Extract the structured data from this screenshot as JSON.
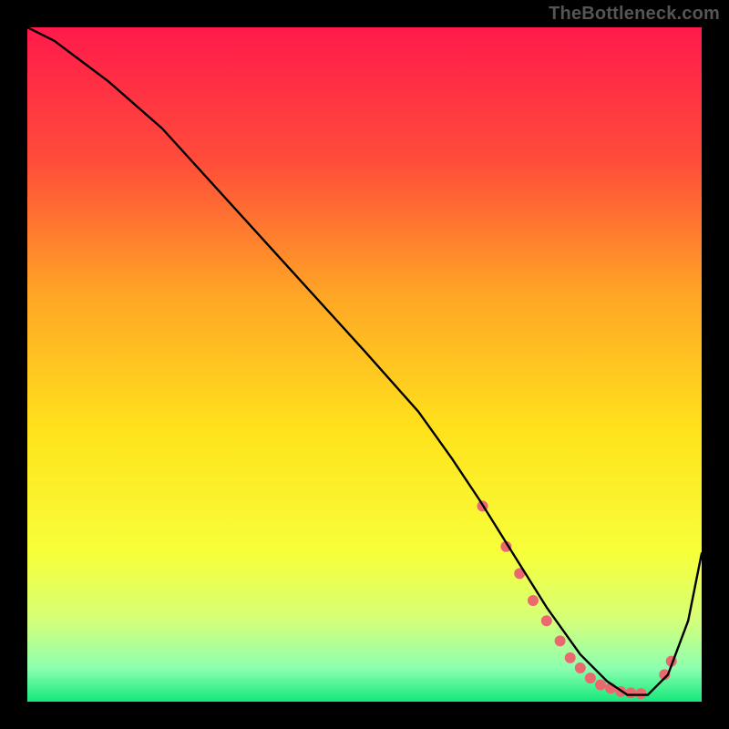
{
  "watermark": "TheBottleneck.com",
  "chart_data": {
    "type": "line",
    "title": "",
    "xlabel": "",
    "ylabel": "",
    "xlim": [
      0,
      100
    ],
    "ylim": [
      0,
      100
    ],
    "grid": false,
    "legend": false,
    "gradient_stops": [
      {
        "offset": 0,
        "color": "#ff1a4b"
      },
      {
        "offset": 20,
        "color": "#ff4d3a"
      },
      {
        "offset": 40,
        "color": "#ffa725"
      },
      {
        "offset": 60,
        "color": "#ffe31c"
      },
      {
        "offset": 78,
        "color": "#f7ff3a"
      },
      {
        "offset": 88,
        "color": "#d4ff7a"
      },
      {
        "offset": 95,
        "color": "#8dffb0"
      },
      {
        "offset": 100,
        "color": "#15e87b"
      }
    ],
    "series": [
      {
        "name": "bottleneck-curve",
        "color": "#000000",
        "x": [
          0,
          4,
          8,
          12,
          20,
          30,
          40,
          50,
          58,
          63,
          67,
          72,
          77,
          82,
          86,
          89,
          92,
          95,
          98,
          100
        ],
        "y": [
          100,
          98,
          95,
          92,
          85,
          74,
          63,
          52,
          43,
          36,
          30,
          22,
          14,
          7,
          3,
          1,
          1,
          4,
          12,
          22
        ]
      }
    ],
    "markers": {
      "name": "highlight-dots",
      "color": "#e9696f",
      "radius": 6,
      "x": [
        67.5,
        71,
        73,
        75,
        77,
        79,
        80.5,
        82,
        83.5,
        85,
        86.5,
        88,
        89.5,
        91,
        94.5,
        95.5
      ],
      "y": [
        29,
        23,
        19,
        15,
        12,
        9,
        6.5,
        5,
        3.5,
        2.5,
        2,
        1.5,
        1.3,
        1.2,
        4,
        6
      ]
    }
  }
}
